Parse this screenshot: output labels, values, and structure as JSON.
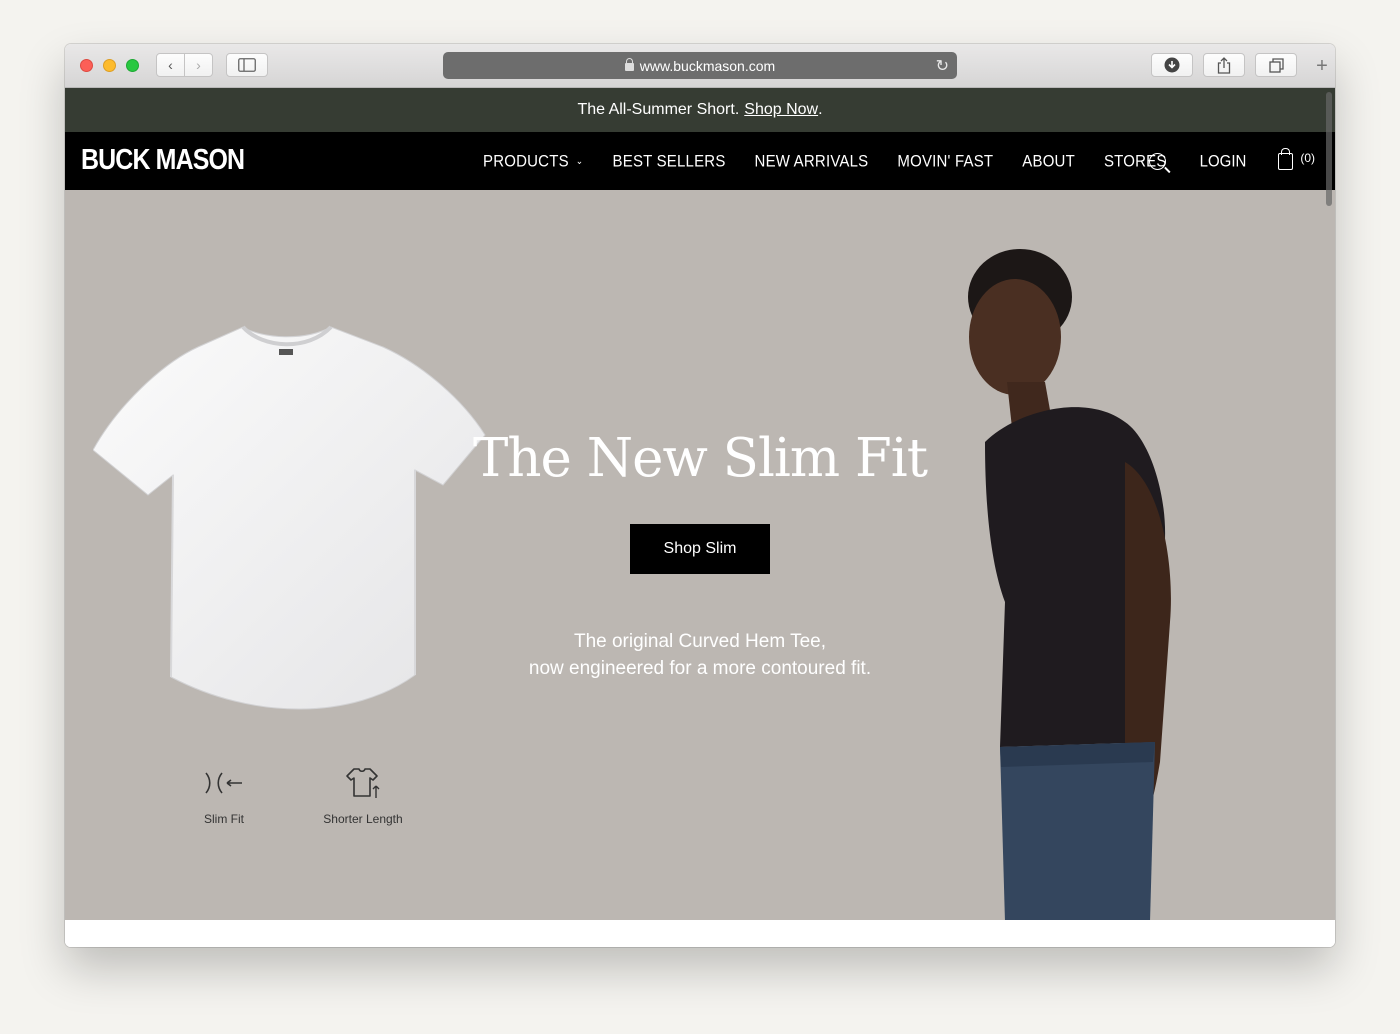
{
  "browser": {
    "url": "www.buckmason.com"
  },
  "promo": {
    "text": "The All-Summer Short.",
    "link": "Shop Now",
    "period": "."
  },
  "nav": {
    "logo": "BUCK MASON",
    "items": [
      {
        "label": "PRODUCTS"
      },
      {
        "label": "BEST SELLERS"
      },
      {
        "label": "NEW ARRIVALS"
      },
      {
        "label": "MOVIN' FAST"
      },
      {
        "label": "ABOUT"
      },
      {
        "label": "STORES"
      }
    ],
    "login": "LOGIN",
    "cart_count": "(0)"
  },
  "hero": {
    "title": "The New Slim Fit",
    "button": "Shop Slim",
    "subtitle_line1": "The original Curved Hem Tee,",
    "subtitle_line2": "now engineered for a more contoured fit.",
    "features": [
      {
        "label": "Slim Fit",
        "icon": "slim-fit-icon"
      },
      {
        "label": "Shorter Length",
        "icon": "shorter-length-icon"
      }
    ]
  },
  "colors": {
    "promo_bg": "#363c33",
    "nav_bg": "#000000",
    "hero_bg": "#bcb7b2"
  }
}
